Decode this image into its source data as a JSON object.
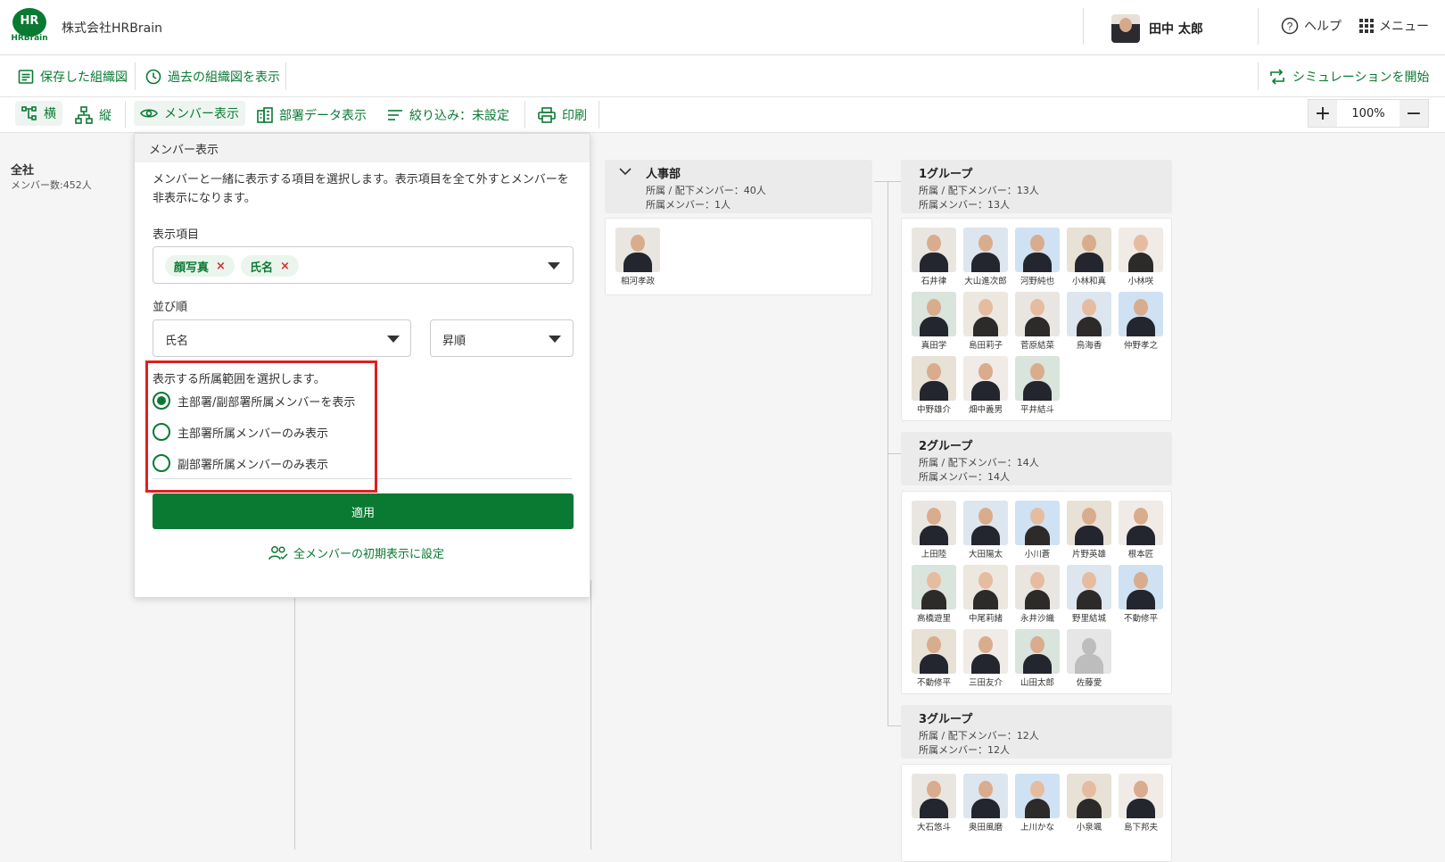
{
  "header": {
    "logo_text": "HR",
    "logo_sub": "HRBrain",
    "company": "株式会社HRBrain",
    "user_name": "田中 太郎",
    "help_label": "ヘルプ",
    "menu_label": "メニュー"
  },
  "toolbar1": {
    "saved_label": "保存した組織図",
    "past_label": "過去の組織図を表示",
    "simulation_label": "シミュレーションを開始"
  },
  "toolbar2": {
    "horizontal_label": "横",
    "vertical_label": "縦",
    "member_view_label": "メンバー表示",
    "dept_data_label": "部署データ表示",
    "filter_label": "絞り込み：未設定",
    "print_label": "印刷",
    "zoom_value": "100%",
    "zoom_in": "+",
    "zoom_out": "−"
  },
  "root": {
    "title": "全社",
    "member_count": "メンバー数:452人"
  },
  "panel": {
    "title": "メンバー表示",
    "description": "メンバーと一緒に表示する項目を選択します。表示項目を全て外すとメンバーを非表示になります。",
    "display_items_label": "表示項目",
    "tags": [
      "顔写真",
      "氏名"
    ],
    "tag_remove": "×",
    "sort_label": "並び順",
    "sort_field": "氏名",
    "sort_order": "昇順",
    "scope_label": "表示する所属範囲を選択します。",
    "scope_options": [
      "主部署/副部署所属メンバーを表示",
      "主部署所属メンバーのみ表示",
      "副部署所属メンバーのみ表示"
    ],
    "scope_selected_index": 0,
    "apply_label": "適用",
    "reset_label": "全メンバーの初期表示に設定"
  },
  "hr_dept": {
    "title": "人事部",
    "line1": "所属 / 配下メンバー：40人",
    "line2": "所属メンバー：1人",
    "members": [
      "相河孝政"
    ]
  },
  "groups": [
    {
      "title": "1グループ",
      "line1": "所属 / 配下メンバー：13人",
      "line2": "所属メンバー：13人",
      "members": [
        "石井律",
        "大山進次郎",
        "河野純也",
        "小林和真",
        "小林咲",
        "真田学",
        "島田莉子",
        "菅原結菜",
        "鳥海香",
        "仲野孝之",
        "中野雄介",
        "畑中義男",
        "平井結斗"
      ]
    },
    {
      "title": "2グループ",
      "line1": "所属 / 配下メンバー：14人",
      "line2": "所属メンバー：14人",
      "members": [
        "上田陸",
        "大田陽太",
        "小川蒼",
        "片野英雄",
        "根本匠",
        "高橋遊里",
        "中尾莉緒",
        "永井沙織",
        "野里結城",
        "不動修平",
        "不動修平",
        "三田友介",
        "山田太郎",
        "佐藤愛"
      ]
    },
    {
      "title": "3グループ",
      "line1": "所属 / 配下メンバー：12人",
      "line2": "所属メンバー：12人",
      "members": [
        "大石悠斗",
        "奥田風磨",
        "上川かな",
        "小泉颯",
        "島下邦夫"
      ]
    }
  ],
  "colors": {
    "brand": "#0a7a33",
    "highlight": "#e02020"
  }
}
